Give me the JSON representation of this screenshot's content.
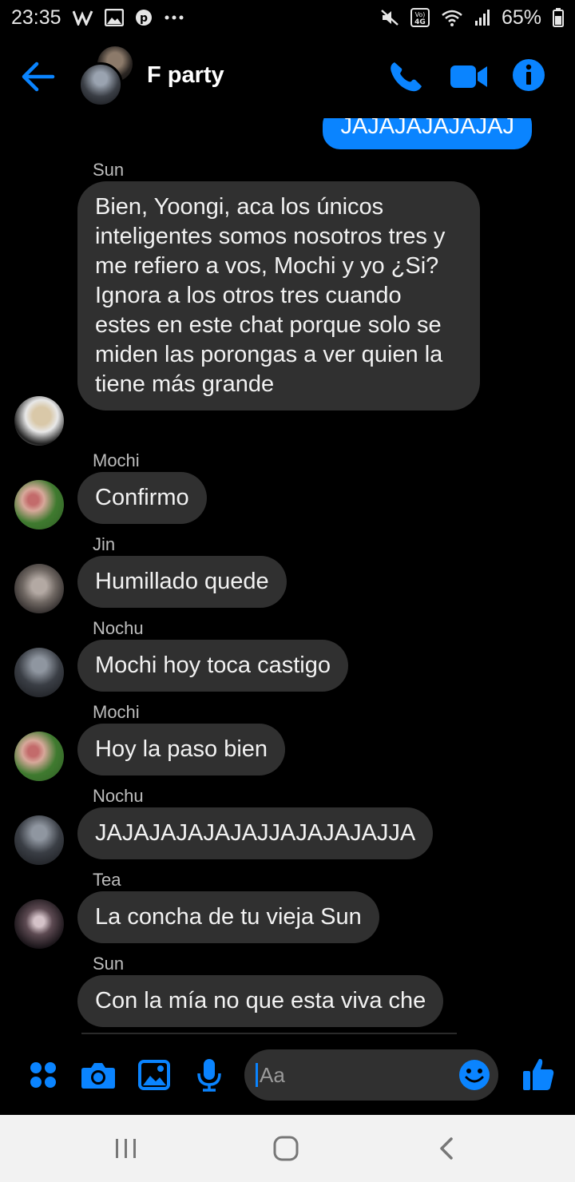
{
  "status_bar": {
    "time": "23:35",
    "battery": "65%",
    "icons_left": [
      "wordpress-icon",
      "gallery-icon",
      "pinterest-icon",
      "more-dots-icon"
    ],
    "icons_right": [
      "mute-icon",
      "volte-4g-icon",
      "wifi-icon",
      "signal-icon",
      "battery-icon"
    ],
    "volte_label": "Vo) 4G"
  },
  "header": {
    "title": "F party"
  },
  "messages": [
    {
      "type": "sent",
      "text": "JAJAJAJAJAJAJ"
    },
    {
      "type": "received",
      "sender": "Sun",
      "text": "Bien, Yoongi, aca los únicos inteligentes somos nosotros tres y me refiero a vos, Mochi y yo ¿Si? Ignora a los otros tres cuando estes en este chat porque solo se miden las porongas a ver quien la tiene más grande"
    },
    {
      "type": "received",
      "sender": "Mochi",
      "text": "Confirmo"
    },
    {
      "type": "received",
      "sender": "Jin",
      "text": "Humillado quede"
    },
    {
      "type": "received",
      "sender": "Nochu",
      "text": "Mochi hoy toca castigo"
    },
    {
      "type": "received",
      "sender": "Mochi",
      "text": "Hoy la paso bien"
    },
    {
      "type": "received",
      "sender": "Nochu",
      "text": "JAJAJAJAJAJAJJAJAJAJAJJA"
    },
    {
      "type": "received",
      "sender": "Tea",
      "text": "La concha de tu vieja Sun"
    },
    {
      "type": "received",
      "sender": "Sun",
      "text": "Con la mía no que esta viva che"
    }
  ],
  "composer": {
    "placeholder": "Aa"
  },
  "colors": {
    "accent": "#0a84ff",
    "bubble_received": "#303030",
    "background": "#000000"
  }
}
